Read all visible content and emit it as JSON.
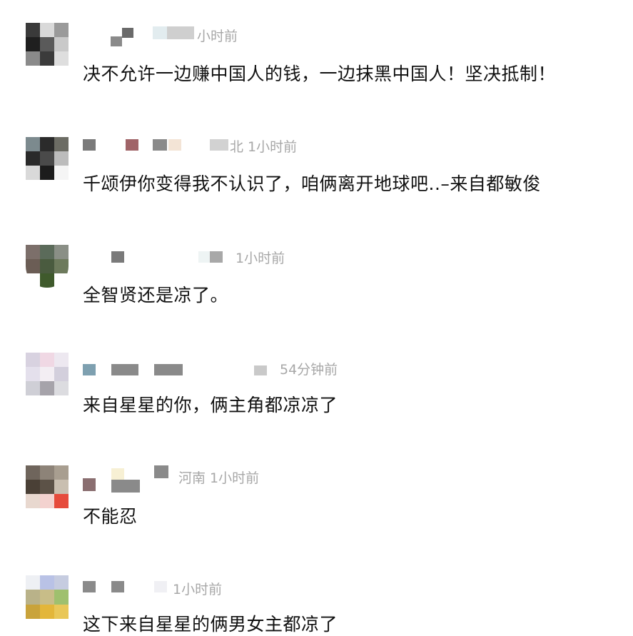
{
  "comments": [
    {
      "location": "",
      "time": "小时前",
      "text": "决不允许一边赚中国人的钱，一边抹黑中国人！坚决抵制！",
      "avatar_colors": [
        "#3a3a3a",
        "#d9d9d9",
        "#9a9a9a",
        "#1f1f1f",
        "#5a5a5a",
        "#c9c9c9",
        "#8a8a8a",
        "#3b3b3b",
        "#dedede"
      ]
    },
    {
      "location": "北",
      "time": "1小时前",
      "text": "千颂伊你变得我不认识了，咱俩离开地球吧..–来自都敏俊",
      "avatar_colors": [
        "#7c8a8e",
        "#2b2b2b",
        "#6c6c64",
        "#2a2a2a",
        "#4a4a4a",
        "#bcbcbc",
        "#d9d9d9",
        "#1c1c1c",
        "#f5f5f5"
      ]
    },
    {
      "location": "",
      "time": "1小时前",
      "text": "全智贤还是凉了。",
      "avatar_colors": [
        "#7c6f6a",
        "#5b6b5a",
        "#8a8f86",
        "#6b5d55",
        "#4a5b3f",
        "#6d7a5c",
        "#ffffff",
        "#3f5a2c",
        "#ffffff"
      ]
    },
    {
      "location": "",
      "time": "54分钟前",
      "text": "来自星星的你，俩主角都凉凉了",
      "avatar_colors": [
        "#d8d2e0",
        "#f0d8e4",
        "#ede8f0",
        "#e4e0ec",
        "#f3eef3",
        "#d3cfdc",
        "#cfcfd6",
        "#a6a3aa",
        "#dcdce0"
      ]
    },
    {
      "location": "河南",
      "time": "1小时前",
      "text": "不能忍",
      "avatar_colors": [
        "#6f655c",
        "#8d8378",
        "#a89e90",
        "#4a4036",
        "#5c5247",
        "#c9bfb0",
        "#e8d8cf",
        "#f3d2cf",
        "#e64b3c"
      ]
    },
    {
      "location": "",
      "time": "1小时前",
      "text": "这下来自星星的俩男女主都凉了",
      "avatar_colors": [
        "#eef0f4",
        "#b9c2e6",
        "#c6cce0",
        "#b9b289",
        "#c8bd88",
        "#9fc06e",
        "#c9a33b",
        "#e3b63a",
        "#e9c758"
      ]
    }
  ]
}
